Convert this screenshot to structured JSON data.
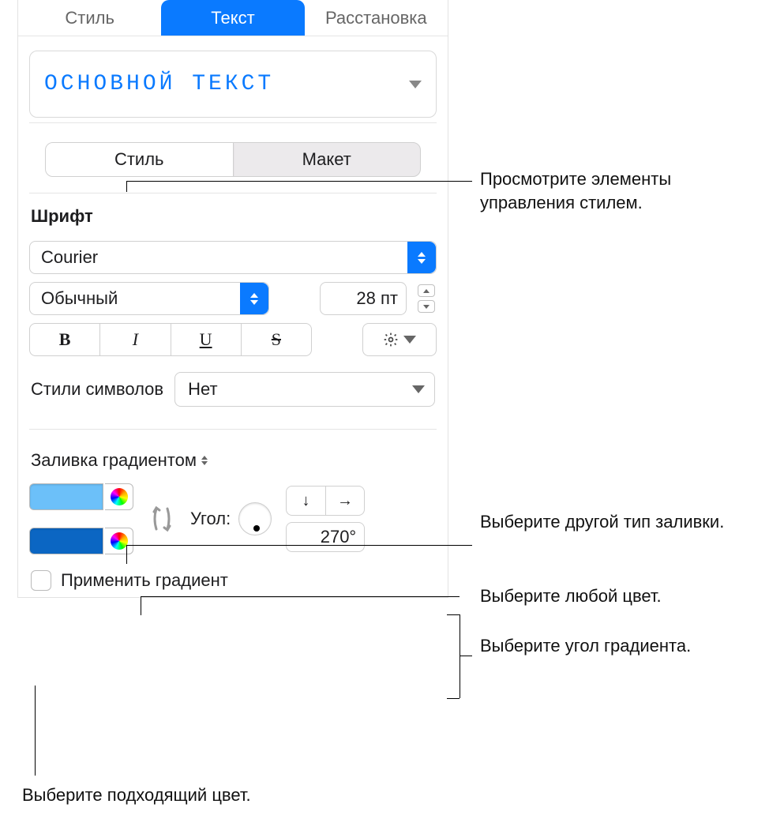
{
  "tabs": {
    "style": "Стиль",
    "text": "Текст",
    "arrange": "Расстановка"
  },
  "style_name": "ОСНОВНОЙ ТЕКСТ",
  "segment": {
    "style": "Стиль",
    "layout": "Макет"
  },
  "font": {
    "section_label": "Шрифт",
    "family": "Courier",
    "weight": "Обычный",
    "size": "28 пт",
    "btn_bold": "B",
    "btn_italic": "I",
    "btn_underline": "U",
    "btn_strike": "S"
  },
  "char_styles": {
    "label": "Стили символов",
    "value": "Нет"
  },
  "fill": {
    "label": "Заливка градиентом",
    "color1": "#6cc0f9",
    "color2": "#0b66c3",
    "angle_label": "Угол:",
    "angle_value": "270°",
    "arrow_down": "↓",
    "arrow_right": "→"
  },
  "apply_gradient": "Применить градиент",
  "callouts": {
    "c1": "Просмотрите элементы управления стилем.",
    "c2": "Выберите другой тип заливки.",
    "c3": "Выберите любой цвет.",
    "c4": "Выберите угол градиента.",
    "c5": "Выберите подходящий цвет."
  }
}
